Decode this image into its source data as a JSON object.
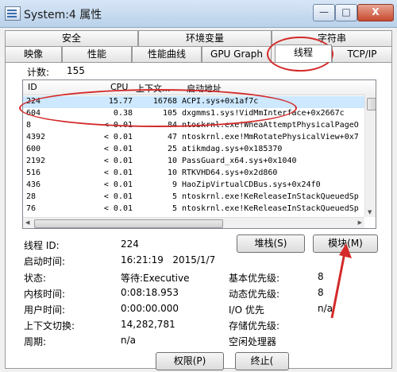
{
  "window": {
    "title": "System:4 属性",
    "min_glyph": "—",
    "max_glyph": "□",
    "close_glyph": "X"
  },
  "tabs_row1": [
    "安全",
    "环境变量",
    "字符串"
  ],
  "tabs_row2": [
    "映像",
    "性能",
    "性能曲线",
    "GPU Graph",
    "线程",
    "TCP/IP"
  ],
  "active_tab": "线程",
  "count": {
    "label": "计数:",
    "value": "155"
  },
  "list": {
    "headers": {
      "id": "ID",
      "cpu": "CPU",
      "ctx": "上下文...",
      "addr": "启动地址"
    },
    "rows": [
      {
        "id": "224",
        "cpu": "15.77",
        "ctx": "16768",
        "addr": "ACPI.sys+0x1af7c"
      },
      {
        "id": "604",
        "cpu": "0.38",
        "ctx": "105",
        "addr": "dxgmms1.sys!VidMmInterface+0x2667c"
      },
      {
        "id": "8",
        "cpu": "< 0.01",
        "ctx": "84",
        "addr": "ntoskrnl.exe!WheaAttemptPhysicalPageO"
      },
      {
        "id": "4392",
        "cpu": "< 0.01",
        "ctx": "47",
        "addr": "ntoskrnl.exe!MmRotatePhysicalView+0x7"
      },
      {
        "id": "600",
        "cpu": "< 0.01",
        "ctx": "25",
        "addr": "atikmdag.sys+0x185370"
      },
      {
        "id": "2192",
        "cpu": "< 0.01",
        "ctx": "10",
        "addr": "PassGuard_x64.sys+0x1040"
      },
      {
        "id": "516",
        "cpu": "< 0.01",
        "ctx": "10",
        "addr": "RTKVHD64.sys+0x2d860"
      },
      {
        "id": "436",
        "cpu": "< 0.01",
        "ctx": "9",
        "addr": "HaoZipVirtualCDBus.sys+0x24f0"
      },
      {
        "id": "28",
        "cpu": "< 0.01",
        "ctx": "5",
        "addr": "ntoskrnl.exe!KeReleaseInStackQueuedSp"
      },
      {
        "id": "76",
        "cpu": "< 0.01",
        "ctx": "5",
        "addr": "ntoskrnl.exe!KeReleaseInStackQueuedSp"
      }
    ],
    "selected_index": 0,
    "scroll_arrows": {
      "up": "▲",
      "down": "▼",
      "left": "◀",
      "right": "▶"
    }
  },
  "buttons": {
    "stack": "堆栈(S)",
    "module": "模块(M)",
    "permissions": "权限(P)",
    "terminate": "终止("
  },
  "details": {
    "thread_id_label": "线程 ID:",
    "thread_id_value": "224",
    "start_time_label": "启动时间:",
    "start_time_value": "16:21:19   2015/1/7",
    "state_label": "状态:",
    "state_value": "等待:Executive",
    "kernel_time_label": "内核时间:",
    "kernel_time_value": "0:08:18.953",
    "user_time_label": "用户时间:",
    "user_time_value": "0:00:00.000",
    "ctx_switch_label": "上下文切换:",
    "ctx_switch_value": "14,282,781",
    "cycles_label": "周期:",
    "cycles_value": "n/a",
    "base_priority_label": "基本优先级:",
    "base_priority_value": "8",
    "dynamic_priority_label": "动态优先级:",
    "dynamic_priority_value": "8",
    "io_priority_label": "I/O 优先",
    "io_priority_value": "n/a",
    "memory_priority_label": "存储优先级:",
    "ideal_processor_label": "空闲处理器"
  },
  "colors": {
    "annotation": "#d42a2a",
    "selection": "#cde8ff"
  }
}
